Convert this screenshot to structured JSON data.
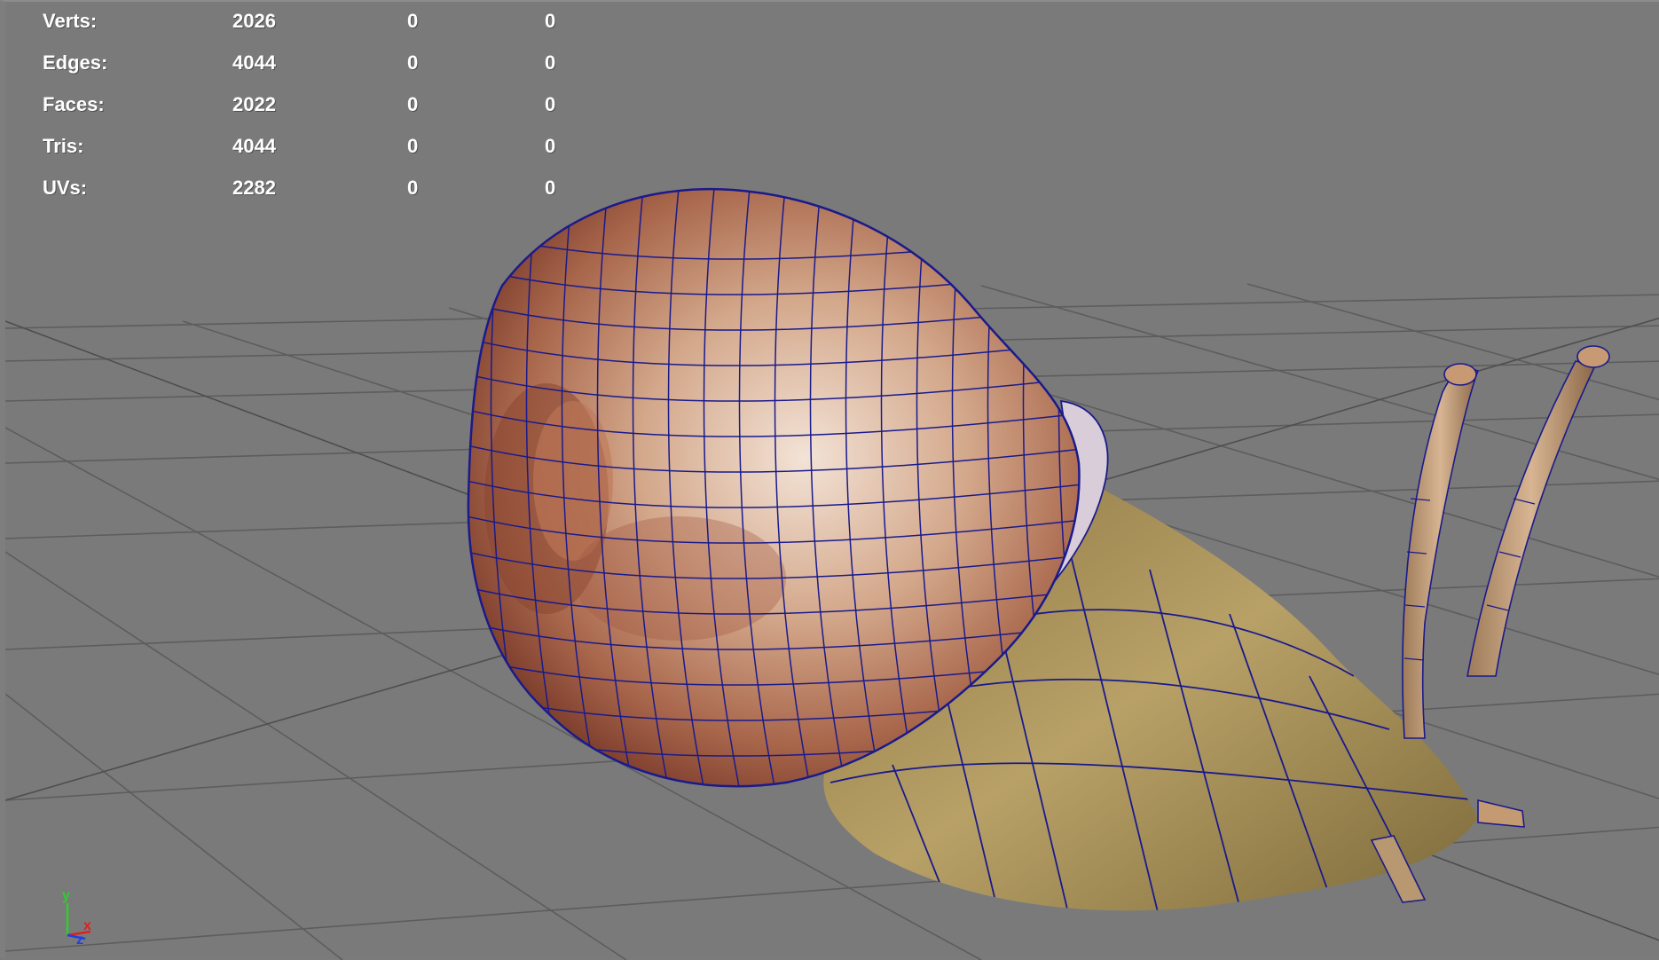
{
  "hud": {
    "rows": [
      {
        "label": "Verts:",
        "count": "2026",
        "selected": "0",
        "uv_selected": "0"
      },
      {
        "label": "Edges:",
        "count": "4044",
        "selected": "0",
        "uv_selected": "0"
      },
      {
        "label": "Faces:",
        "count": "2022",
        "selected": "0",
        "uv_selected": "0"
      },
      {
        "label": "Tris:",
        "count": "4044",
        "selected": "0",
        "uv_selected": "0"
      },
      {
        "label": "UVs:",
        "count": "2282",
        "selected": "0",
        "uv_selected": "0"
      }
    ]
  },
  "axis": {
    "y": "y",
    "x": "x",
    "z": "z"
  },
  "colors": {
    "viewport_bg": "#7a7a7a",
    "grid": "#5f5f5f",
    "wireframe": "#1a1a8c",
    "shell": "#c08a6a",
    "body": "#a08a50",
    "hud_text": "#ffffff",
    "axis_y": "#2ad02a",
    "axis_x": "#e02020",
    "axis_z": "#2040e0"
  }
}
